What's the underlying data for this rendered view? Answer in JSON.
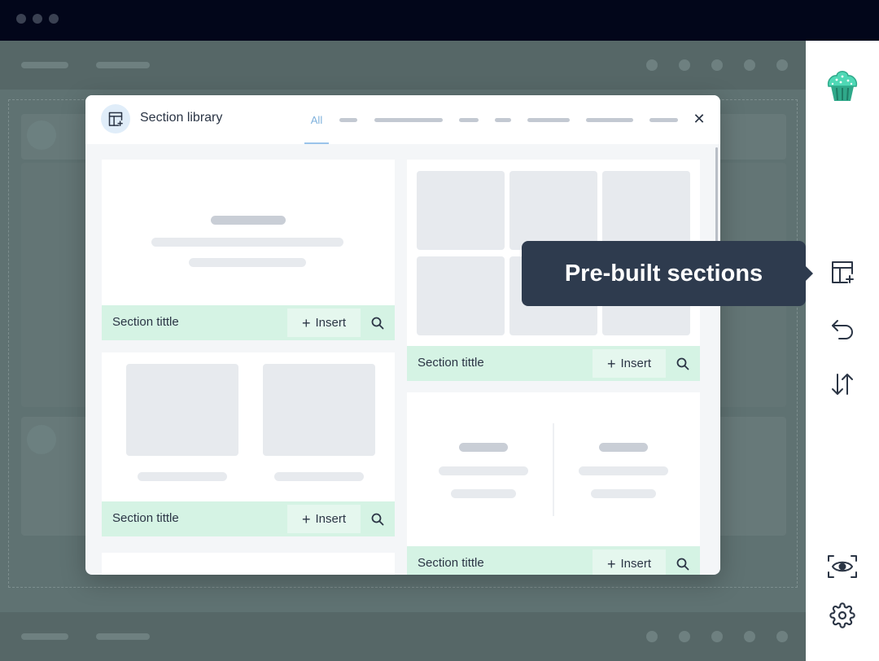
{
  "modal": {
    "title": "Section library",
    "tabs": {
      "all_label": "All"
    },
    "close_glyph": "✕"
  },
  "cards": [
    {
      "title": "Section tittle",
      "insert_label": "Insert"
    },
    {
      "title": "Section tittle",
      "insert_label": "Insert"
    },
    {
      "title": "Section tittle",
      "insert_label": "Insert"
    },
    {
      "title": "Section tittle",
      "insert_label": "Insert"
    }
  ],
  "tooltip": {
    "text": "Pre-built sections"
  },
  "sidebar": {
    "icons": [
      "cupcake-logo-icon",
      "section-library-icon",
      "undo-icon",
      "reorder-icon",
      "preview-eye-icon",
      "gear-icon"
    ]
  },
  "colors": {
    "accent_green": "#d5f3e4",
    "tab_active": "#7fb1dc",
    "tooltip_bg": "#2e3b4e",
    "logo_teal": "#3ec9a7"
  }
}
